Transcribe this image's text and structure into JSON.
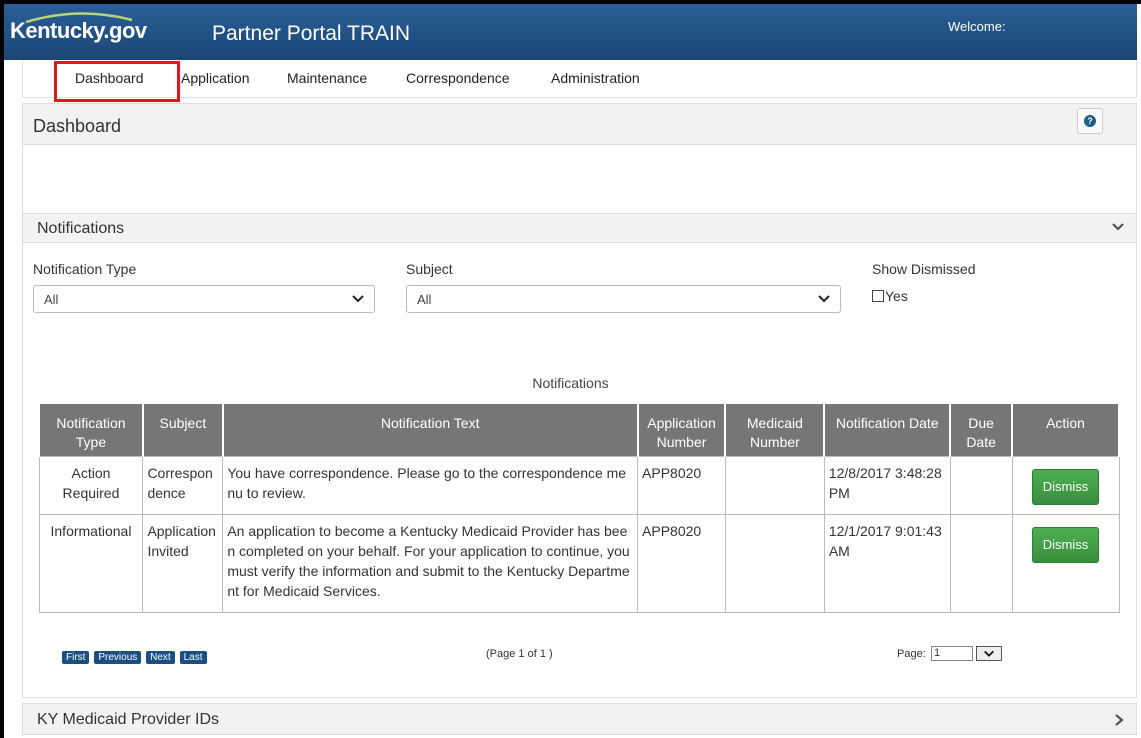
{
  "header": {
    "logo_text": "Kentucky.gov",
    "portal_title": "Partner Portal TRAIN",
    "welcome": "Welcome:"
  },
  "nav": {
    "items": [
      {
        "label": "Dashboard"
      },
      {
        "label": "Application"
      },
      {
        "label": "Maintenance"
      },
      {
        "label": "Correspondence"
      },
      {
        "label": "Administration"
      }
    ],
    "active": "Dashboard",
    "highlight_color": "#e8141b"
  },
  "dashboard": {
    "title": "Dashboard",
    "help_icon": "?"
  },
  "notifications": {
    "title": "Notifications",
    "filters": {
      "type_label": "Notification Type",
      "type_value": "All",
      "subject_label": "Subject",
      "subject_value": "All",
      "dismissed_label": "Show Dismissed",
      "dismissed_option": "Yes"
    },
    "table_caption": "Notifications",
    "columns": {
      "type": "Notification Type",
      "subject": "Subject",
      "text": "Notification Text",
      "app_number": "Application Number",
      "medicaid_number": "Medicaid Number",
      "date": "Notification Date",
      "due_date": "Due Date",
      "action": "Action"
    },
    "rows": [
      {
        "type": "Action Required",
        "subject": "Correspondence",
        "text": "You have correspondence. Please go to the correspondence menu to review.",
        "app_number": "APP8020",
        "medicaid_number": "",
        "date": "12/8/2017 3:48:28 PM",
        "due_date": "",
        "action": "Dismiss"
      },
      {
        "type": "Informational",
        "subject": "Application Invited",
        "text": "An application to become a Kentucky Medicaid Provider has been completed on your behalf. For your application to continue, you must verify the information and submit to the Kentucky Department for Medicaid Services.",
        "app_number": "APP8020",
        "medicaid_number": "",
        "date": "12/1/2017 9:01:43 AM",
        "due_date": "",
        "action": "Dismiss"
      }
    ],
    "pager": {
      "first": "First",
      "previous": "Previous",
      "next": "Next",
      "last": "Last",
      "page_of": "(Page 1 of 1 )",
      "page_label": "Page:",
      "page_value": "1"
    }
  },
  "ky_section": {
    "title": "KY Medicaid Provider IDs"
  },
  "colors": {
    "header_bg": "#1f4f82",
    "table_header_bg": "#767676",
    "dismiss_green": "#43a047"
  }
}
